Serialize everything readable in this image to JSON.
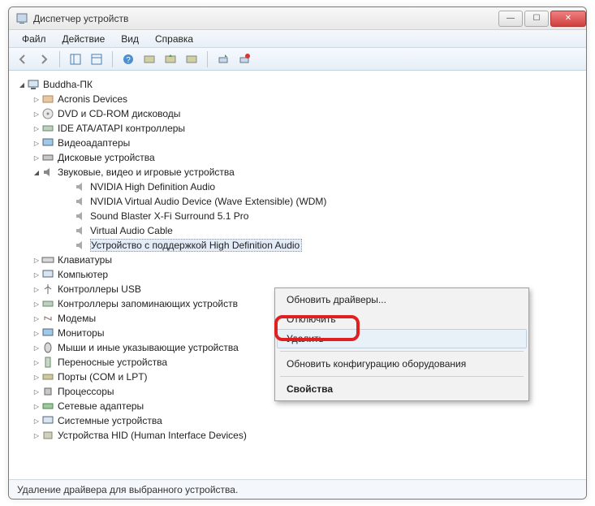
{
  "window": {
    "title": "Диспетчер устройств"
  },
  "menubar": {
    "file": "Файл",
    "action": "Действие",
    "view": "Вид",
    "help": "Справка"
  },
  "tree": {
    "root": "Buddha-ПК",
    "items": [
      "Acronis Devices",
      "DVD и CD-ROM дисководы",
      "IDE ATA/ATAPI контроллеры",
      "Видеоадаптеры",
      "Дисковые устройства",
      "Звуковые, видео и игровые устройства",
      "Клавиатуры",
      "Компьютер",
      "Контроллеры USB",
      "Контроллеры запоминающих устройств",
      "Модемы",
      "Мониторы",
      "Мыши и иные указывающие устройства",
      "Переносные устройства",
      "Порты (COM и LPT)",
      "Процессоры",
      "Сетевые адаптеры",
      "Системные устройства",
      "Устройства HID (Human Interface Devices)"
    ],
    "sound_children": [
      "NVIDIA High Definition Audio",
      "NVIDIA Virtual Audio Device (Wave Extensible) (WDM)",
      "Sound Blaster X-Fi Surround 5.1 Pro",
      "Virtual Audio Cable",
      "Устройство с поддержкой High Definition Audio"
    ]
  },
  "ctx": {
    "update": "Обновить драйверы...",
    "disable": "Отключить",
    "delete": "Удалить",
    "refresh": "Обновить конфигурацию оборудования",
    "properties": "Свойства"
  },
  "statusbar": "Удаление драйвера для выбранного устройства."
}
